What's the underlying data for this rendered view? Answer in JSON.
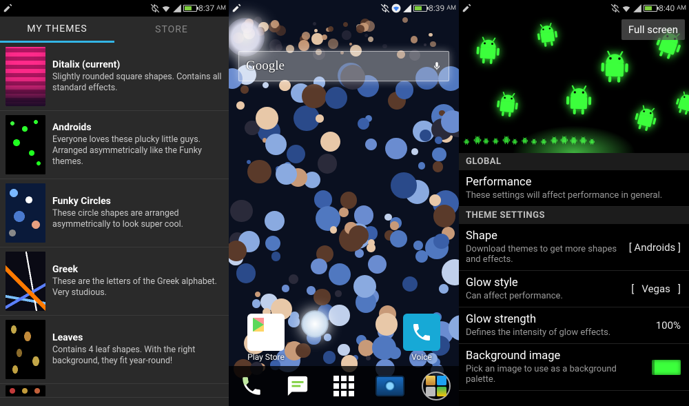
{
  "panel1": {
    "status": {
      "time": "8:37",
      "ampm": "AM"
    },
    "tabs": {
      "mythemes": "MY THEMES",
      "store": "STORE"
    },
    "themes": [
      {
        "name": "Ditalix (current)",
        "desc": "Slightly rounded square shapes. Contains all standard effects."
      },
      {
        "name": "Androids",
        "desc": "Everyone loves these plucky little guys. Arranged asymmetrically like the Funky themes."
      },
      {
        "name": "Funky Circles",
        "desc": "These circle shapes are arranged asymmetrically to look super cool."
      },
      {
        "name": "Greek",
        "desc": "These are the letters of the Greek alphabet. Very studious."
      },
      {
        "name": "Leaves",
        "desc": "Contains 4 leaf shapes. With the right background, they fit year-round!"
      }
    ]
  },
  "panel2": {
    "status": {
      "time": "8:39",
      "ampm": "AM"
    },
    "search_brand": "Google",
    "apps": {
      "playstore": "Play Store",
      "voice": "Voice"
    }
  },
  "panel3": {
    "status": {
      "time": "8:40",
      "ampm": "AM"
    },
    "fullscreen": "Full screen",
    "sections": {
      "global": "GLOBAL",
      "theme": "THEME SETTINGS"
    },
    "settings": {
      "performance": {
        "title": "Performance",
        "sub": "These settings will affect performance in general."
      },
      "shape": {
        "title": "Shape",
        "sub": "Download themes to get more shapes and effects.",
        "value": "[ Androids ]"
      },
      "glowstyle": {
        "title": "Glow style",
        "sub": "Can affect performance.",
        "value": "[   Vegas   ]"
      },
      "glowstrength": {
        "title": "Glow strength",
        "sub": "Defines the intensity of glow effects.",
        "value": "100%"
      },
      "bgimage": {
        "title": "Background image",
        "sub": "Pick an image to use as a background palette."
      }
    }
  }
}
